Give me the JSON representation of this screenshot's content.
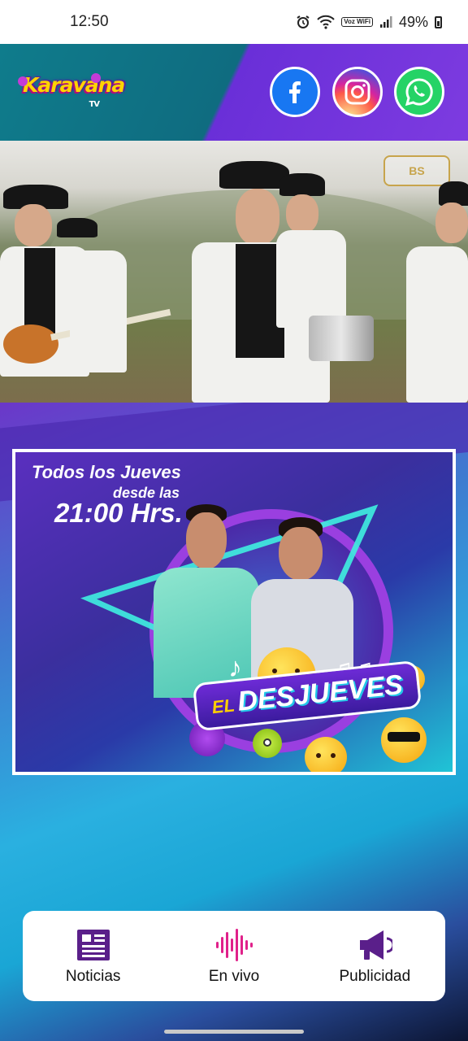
{
  "status_bar": {
    "time": "12:50",
    "battery": "49%",
    "network_label": "Voz WiFi",
    "icons": [
      "alarm-icon",
      "wifi-icon",
      "voz-wifi-icon",
      "signal-icon",
      "battery-icon"
    ]
  },
  "header": {
    "logo_text": "Karavana",
    "logo_tv": "TV",
    "social": [
      {
        "name": "facebook",
        "icon": "facebook-icon",
        "color": "#1877f2"
      },
      {
        "name": "instagram",
        "icon": "instagram-icon",
        "color": "#d6249f"
      },
      {
        "name": "whatsapp",
        "icon": "whatsapp-icon",
        "color": "#25d366"
      }
    ]
  },
  "video": {
    "badge": "BS"
  },
  "promo": {
    "line1": "Todos los Jueves",
    "line2": "desde las",
    "line3": "21:00 Hrs.",
    "title_prefix": "EL",
    "title": "DESJUEVES"
  },
  "bottom_nav": {
    "items": [
      {
        "label": "Noticias",
        "icon": "newspaper-icon",
        "color": "#5a1f8a"
      },
      {
        "label": "En vivo",
        "icon": "audio-waves-icon",
        "color": "#e0218a"
      },
      {
        "label": "Publicidad",
        "icon": "megaphone-icon",
        "color": "#5a1f8a"
      }
    ]
  },
  "colors": {
    "header_teal": "#0f7c8c",
    "header_purple": "#7d3be0",
    "accent_purple": "#5a1f8a",
    "accent_pink": "#e0218a"
  }
}
